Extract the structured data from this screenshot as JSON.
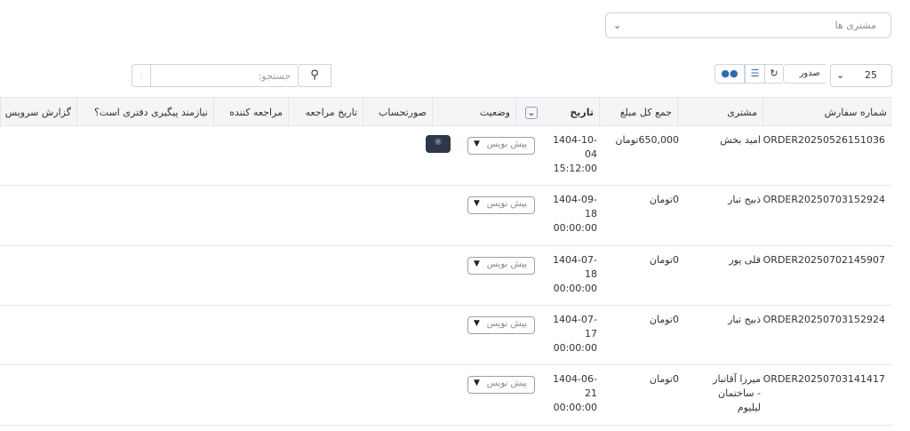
{
  "customer_filter": {
    "placeholder": "مشتری ها",
    "chevron_icon": "chevron-down-icon"
  },
  "toolbar": {
    "per_page": "25",
    "issue_label": "صدور",
    "refresh_icon": "refresh-icon",
    "list_icon": "checklist-icon",
    "users_icon": "users-icon"
  },
  "search": {
    "placeholder": "جستجو:",
    "icon": "search-icon"
  },
  "table": {
    "columns": [
      "شماره سفارش",
      "مشتری",
      "جمع کل مبلغ",
      "تاریخ",
      "وضعیت",
      "صورتحساب",
      "تاریخ مراجعه",
      "مراجعه کننده",
      "نیازمند پیگیری دفتری است؟",
      "گزارش سرویس"
    ],
    "rows": [
      {
        "order": "ORDER20250526151036",
        "customer": "امید بخش",
        "amount": "650,000تومان",
        "date": "1404-10-04 15:12:00",
        "status": "پیش نویس",
        "has_invoice_button": true
      },
      {
        "order": "ORDER20250703152924",
        "customer": "ذبیح تبار",
        "amount": "0تومان",
        "date": "1404-09-18 00:00:00",
        "status": "پیش نویس",
        "has_invoice_button": false
      },
      {
        "order": "ORDER20250702145907",
        "customer": "قلی پور",
        "amount": "0تومان",
        "date": "1404-07-18 00:00:00",
        "status": "پیش نویس",
        "has_invoice_button": false
      },
      {
        "order": "ORDER20250703152924",
        "customer": "ذبیح تبار",
        "amount": "0تومان",
        "date": "1404-07-17 00:00:00",
        "status": "پیش نویس",
        "has_invoice_button": false
      },
      {
        "order": "ORDER20250703141417",
        "customer": "میرزا آقاتبار - ساختمان لیلیوم",
        "amount": "0تومان",
        "date": "1404-06-21 00:00:00",
        "status": "پیش نویس",
        "has_invoice_button": false
      }
    ]
  }
}
